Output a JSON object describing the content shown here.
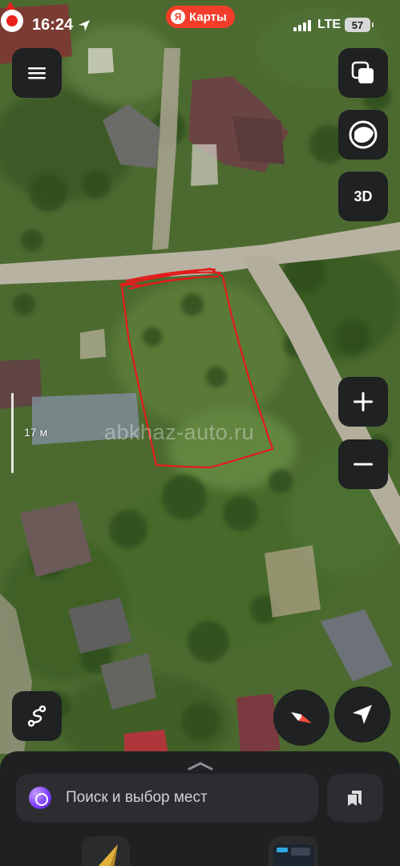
{
  "status_bar": {
    "time": "16:24",
    "app_badge": "Карты",
    "app_logo_letter": "Я",
    "network": "LTE",
    "battery": "57"
  },
  "map": {
    "buttons": {
      "three_d": "3D",
      "zoom_in": "+",
      "zoom_out": "−"
    },
    "scale_label": "17 м",
    "watermark": "abkhaz-auto.ru",
    "parcel_outline_color": "#e31b1b",
    "pin_color": "#e8211b"
  },
  "bottom_sheet": {
    "search_placeholder": "Поиск и выбор мест"
  },
  "icons": [
    "location-arrow-icon",
    "menu-icon",
    "layers-icon",
    "map-style-icon",
    "route-icon",
    "compass-icon",
    "locate-me-icon",
    "alice-icon",
    "bookmarks-icon",
    "chevron-up-icon"
  ]
}
